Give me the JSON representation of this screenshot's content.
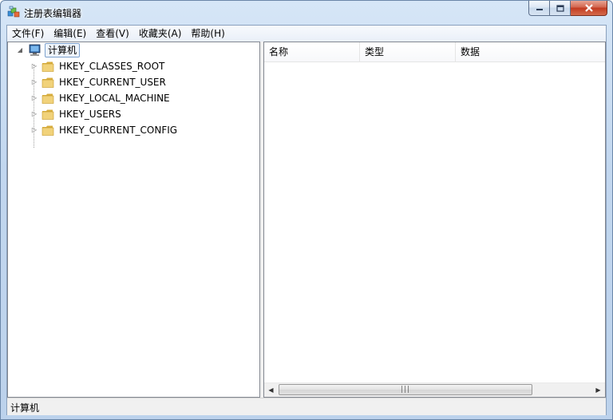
{
  "window": {
    "title": "注册表编辑器"
  },
  "menu": [
    "文件(F)",
    "编辑(E)",
    "查看(V)",
    "收藏夹(A)",
    "帮助(H)"
  ],
  "tree": {
    "root": {
      "label": "计算机",
      "expanded": true,
      "selected": true
    },
    "children": [
      {
        "label": "HKEY_CLASSES_ROOT"
      },
      {
        "label": "HKEY_CURRENT_USER"
      },
      {
        "label": "HKEY_LOCAL_MACHINE"
      },
      {
        "label": "HKEY_USERS"
      },
      {
        "label": "HKEY_CURRENT_CONFIG"
      }
    ]
  },
  "list": {
    "columns": [
      "名称",
      "类型",
      "数据"
    ]
  },
  "status": {
    "text": "计算机"
  },
  "icons": {
    "app": "registry-editor-icon",
    "computer": "computer-icon",
    "folder": "folder-icon"
  },
  "colors": {
    "folder": "#e8c45a",
    "selection_border": "#7da2ce"
  }
}
